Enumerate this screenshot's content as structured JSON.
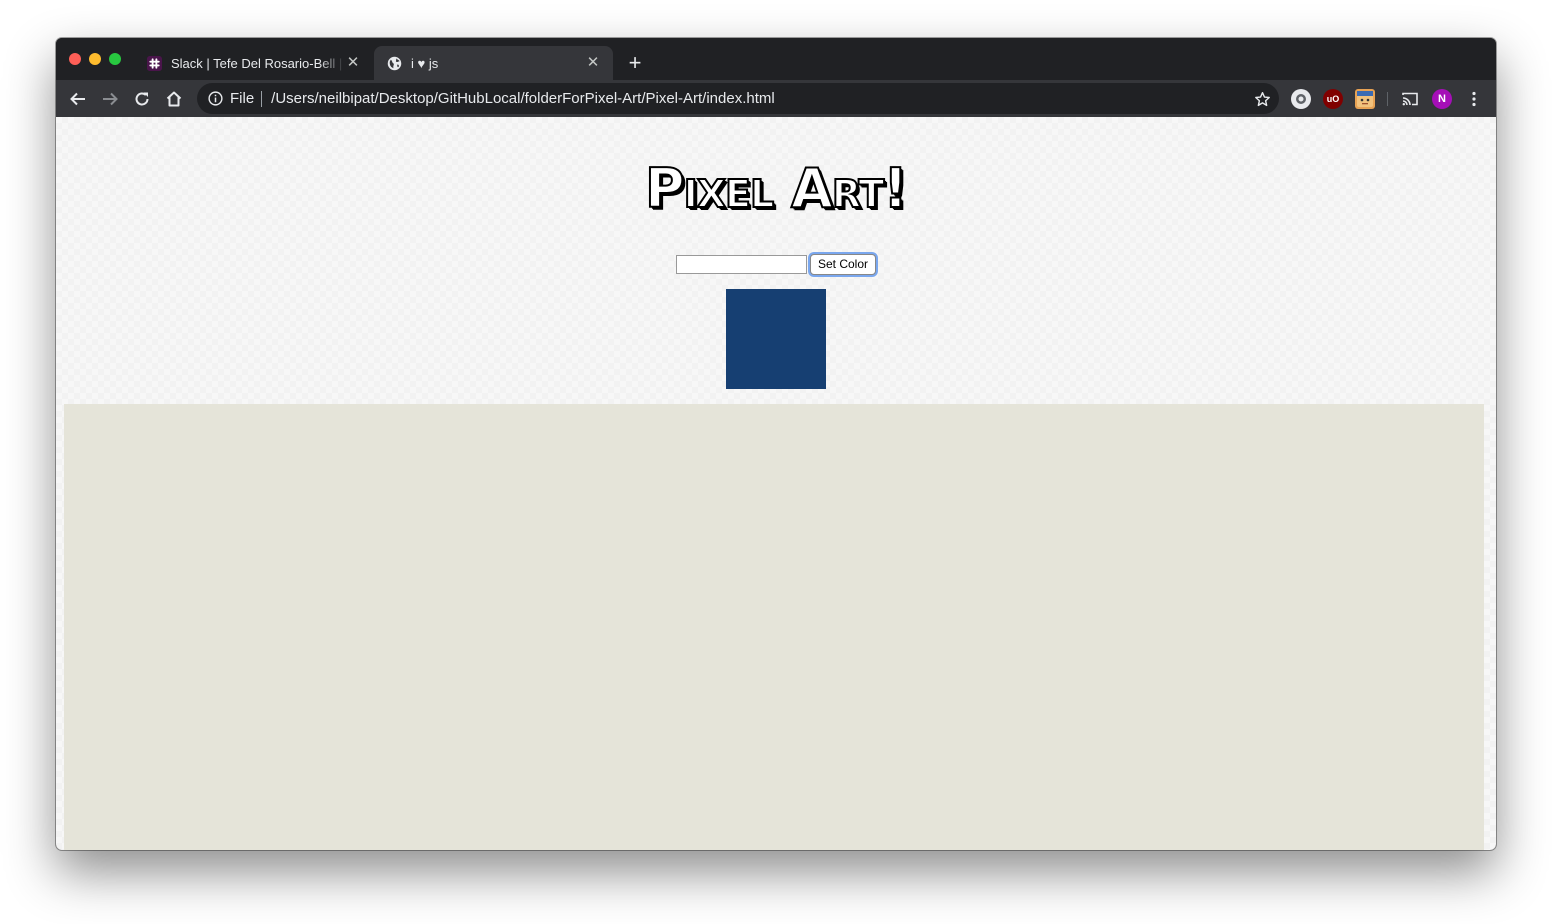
{
  "tabs": [
    {
      "title": "Slack | Tefe Del Rosario-Bell | Github",
      "favicon": "slack-icon",
      "active": false
    },
    {
      "title": "i ♥ js",
      "favicon": "globe-icon",
      "active": true
    }
  ],
  "toolbar": {
    "scheme_label": "File",
    "url": "/Users/neilbipat/Desktop/GitHubLocal/folderForPixel-Art/Pixel-Art/index.html",
    "avatar_initial": "N"
  },
  "page": {
    "title": "Pixel Art!",
    "color_input_value": "",
    "set_color_label": "Set Color",
    "brush_color": "#163f72",
    "canvas_color": "#e5e4d9"
  }
}
